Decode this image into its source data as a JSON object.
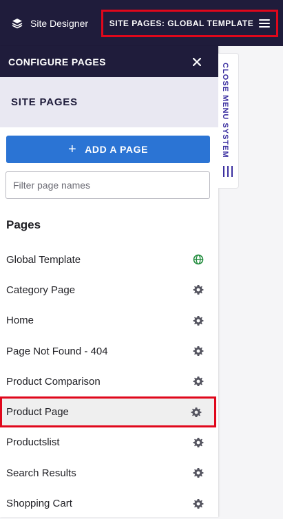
{
  "topbar": {
    "brand_label": "Site Designer",
    "site_pages_button": "SITE PAGES: GLOBAL TEMPLATE"
  },
  "panel": {
    "header_title": "CONFIGURE PAGES",
    "section_title": "SITE PAGES",
    "add_page_label": "ADD A PAGE",
    "filter_placeholder": "Filter page names",
    "filter_value": "",
    "pages_heading": "Pages",
    "pages": [
      {
        "label": "Global Template",
        "icon": "globe-icon"
      },
      {
        "label": "Category Page",
        "icon": "gear-icon"
      },
      {
        "label": "Home",
        "icon": "gear-icon"
      },
      {
        "label": "Page Not Found - 404",
        "icon": "gear-icon"
      },
      {
        "label": "Product Comparison",
        "icon": "gear-icon"
      },
      {
        "label": "Product Page",
        "icon": "gear-icon",
        "selected": true
      },
      {
        "label": "Productslist",
        "icon": "gear-icon"
      },
      {
        "label": "Search Results",
        "icon": "gear-icon"
      },
      {
        "label": "Shopping Cart",
        "icon": "gear-icon"
      }
    ]
  },
  "close_tab": {
    "label": "CLOSE MENU SYSTEM"
  },
  "colors": {
    "nav_bg": "#1f1c3b",
    "accent_blue": "#2b74d4",
    "highlight_red": "#e0071b",
    "globe_green": "#1e8a3a"
  }
}
